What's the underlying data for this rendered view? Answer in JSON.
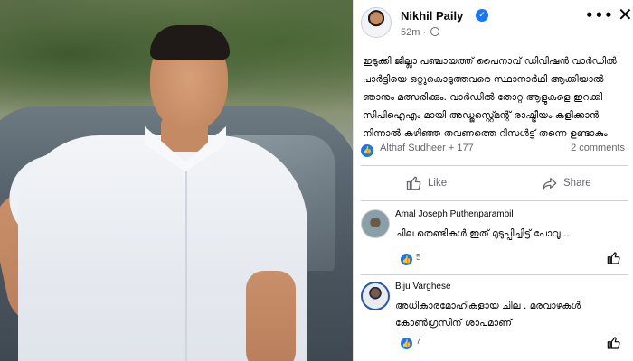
{
  "post": {
    "author": "Nikhil Paily",
    "time": "52m",
    "text": "ഇടുക്കി ജില്ലാ പഞ്ചായത്ത് പൈനാവ് ഡിവിഷൻ വാർഡിൽ പാർട്ടിയെ ഒറ്റുകൊടുത്തവരെ സ്ഥാനാർഥി ആക്കിയാൽ ഞാനും മത്സരിക്കും. വാർഡിൽ തോറ്റ ആളുകളെ ഇറക്കി സിപിഐഎം മായി അഡ്ജസ്റ്റ്മെന്റ് രാഷ്ട്രീയം കളിക്കാൻ നിന്നാൽ കഴിഞ്ഞ തവണത്തെ റിസൾട്ട് തന്നെ ഉണ്ടാകും",
    "reactions_names": "Althaf Sudheer + 177",
    "comments_count": "2 comments",
    "like_label": "Like",
    "share_label": "Share"
  },
  "comments": [
    {
      "name": "Amal Joseph Puthenparambil",
      "text": "ചില തെണ്ടികൾ ഇത് മുടുപ്പിച്ചിട്ട് പോവൂ...",
      "likes": "5"
    },
    {
      "name": "Biju Varghese",
      "text": "അധികാരമോഹികളായ ചില . മരവാഴകൾ കോൺഗ്രസിന് ശാപമാണ്",
      "likes": "7"
    }
  ],
  "icons": {
    "verified": "verified-badge-icon",
    "privacy": "globe-icon",
    "more": "more-options-icon",
    "close": "close-icon",
    "like": "thumbs-up-icon",
    "share": "share-arrow-icon"
  },
  "colors": {
    "accent": "#1877f2",
    "secondary_text": "#65676b"
  }
}
